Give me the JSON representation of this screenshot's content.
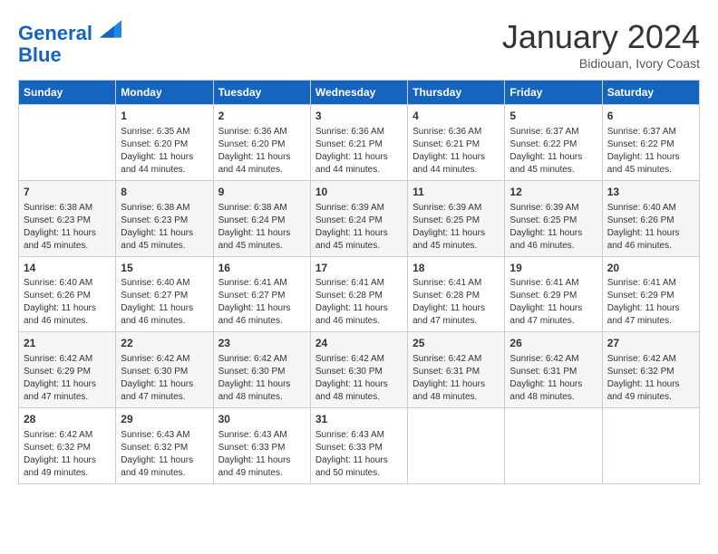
{
  "header": {
    "logo_line1": "General",
    "logo_line2": "Blue",
    "month_title": "January 2024",
    "subtitle": "Bidiouan, Ivory Coast"
  },
  "days_of_week": [
    "Sunday",
    "Monday",
    "Tuesday",
    "Wednesday",
    "Thursday",
    "Friday",
    "Saturday"
  ],
  "weeks": [
    [
      {
        "day": "",
        "info": ""
      },
      {
        "day": "1",
        "info": "Sunrise: 6:35 AM\nSunset: 6:20 PM\nDaylight: 11 hours\nand 44 minutes."
      },
      {
        "day": "2",
        "info": "Sunrise: 6:36 AM\nSunset: 6:20 PM\nDaylight: 11 hours\nand 44 minutes."
      },
      {
        "day": "3",
        "info": "Sunrise: 6:36 AM\nSunset: 6:21 PM\nDaylight: 11 hours\nand 44 minutes."
      },
      {
        "day": "4",
        "info": "Sunrise: 6:36 AM\nSunset: 6:21 PM\nDaylight: 11 hours\nand 44 minutes."
      },
      {
        "day": "5",
        "info": "Sunrise: 6:37 AM\nSunset: 6:22 PM\nDaylight: 11 hours\nand 45 minutes."
      },
      {
        "day": "6",
        "info": "Sunrise: 6:37 AM\nSunset: 6:22 PM\nDaylight: 11 hours\nand 45 minutes."
      }
    ],
    [
      {
        "day": "7",
        "info": "Sunrise: 6:38 AM\nSunset: 6:23 PM\nDaylight: 11 hours\nand 45 minutes."
      },
      {
        "day": "8",
        "info": "Sunrise: 6:38 AM\nSunset: 6:23 PM\nDaylight: 11 hours\nand 45 minutes."
      },
      {
        "day": "9",
        "info": "Sunrise: 6:38 AM\nSunset: 6:24 PM\nDaylight: 11 hours\nand 45 minutes."
      },
      {
        "day": "10",
        "info": "Sunrise: 6:39 AM\nSunset: 6:24 PM\nDaylight: 11 hours\nand 45 minutes."
      },
      {
        "day": "11",
        "info": "Sunrise: 6:39 AM\nSunset: 6:25 PM\nDaylight: 11 hours\nand 45 minutes."
      },
      {
        "day": "12",
        "info": "Sunrise: 6:39 AM\nSunset: 6:25 PM\nDaylight: 11 hours\nand 46 minutes."
      },
      {
        "day": "13",
        "info": "Sunrise: 6:40 AM\nSunset: 6:26 PM\nDaylight: 11 hours\nand 46 minutes."
      }
    ],
    [
      {
        "day": "14",
        "info": "Sunrise: 6:40 AM\nSunset: 6:26 PM\nDaylight: 11 hours\nand 46 minutes."
      },
      {
        "day": "15",
        "info": "Sunrise: 6:40 AM\nSunset: 6:27 PM\nDaylight: 11 hours\nand 46 minutes."
      },
      {
        "day": "16",
        "info": "Sunrise: 6:41 AM\nSunset: 6:27 PM\nDaylight: 11 hours\nand 46 minutes."
      },
      {
        "day": "17",
        "info": "Sunrise: 6:41 AM\nSunset: 6:28 PM\nDaylight: 11 hours\nand 46 minutes."
      },
      {
        "day": "18",
        "info": "Sunrise: 6:41 AM\nSunset: 6:28 PM\nDaylight: 11 hours\nand 47 minutes."
      },
      {
        "day": "19",
        "info": "Sunrise: 6:41 AM\nSunset: 6:29 PM\nDaylight: 11 hours\nand 47 minutes."
      },
      {
        "day": "20",
        "info": "Sunrise: 6:41 AM\nSunset: 6:29 PM\nDaylight: 11 hours\nand 47 minutes."
      }
    ],
    [
      {
        "day": "21",
        "info": "Sunrise: 6:42 AM\nSunset: 6:29 PM\nDaylight: 11 hours\nand 47 minutes."
      },
      {
        "day": "22",
        "info": "Sunrise: 6:42 AM\nSunset: 6:30 PM\nDaylight: 11 hours\nand 47 minutes."
      },
      {
        "day": "23",
        "info": "Sunrise: 6:42 AM\nSunset: 6:30 PM\nDaylight: 11 hours\nand 48 minutes."
      },
      {
        "day": "24",
        "info": "Sunrise: 6:42 AM\nSunset: 6:30 PM\nDaylight: 11 hours\nand 48 minutes."
      },
      {
        "day": "25",
        "info": "Sunrise: 6:42 AM\nSunset: 6:31 PM\nDaylight: 11 hours\nand 48 minutes."
      },
      {
        "day": "26",
        "info": "Sunrise: 6:42 AM\nSunset: 6:31 PM\nDaylight: 11 hours\nand 48 minutes."
      },
      {
        "day": "27",
        "info": "Sunrise: 6:42 AM\nSunset: 6:32 PM\nDaylight: 11 hours\nand 49 minutes."
      }
    ],
    [
      {
        "day": "28",
        "info": "Sunrise: 6:42 AM\nSunset: 6:32 PM\nDaylight: 11 hours\nand 49 minutes."
      },
      {
        "day": "29",
        "info": "Sunrise: 6:43 AM\nSunset: 6:32 PM\nDaylight: 11 hours\nand 49 minutes."
      },
      {
        "day": "30",
        "info": "Sunrise: 6:43 AM\nSunset: 6:33 PM\nDaylight: 11 hours\nand 49 minutes."
      },
      {
        "day": "31",
        "info": "Sunrise: 6:43 AM\nSunset: 6:33 PM\nDaylight: 11 hours\nand 50 minutes."
      },
      {
        "day": "",
        "info": ""
      },
      {
        "day": "",
        "info": ""
      },
      {
        "day": "",
        "info": ""
      }
    ]
  ]
}
